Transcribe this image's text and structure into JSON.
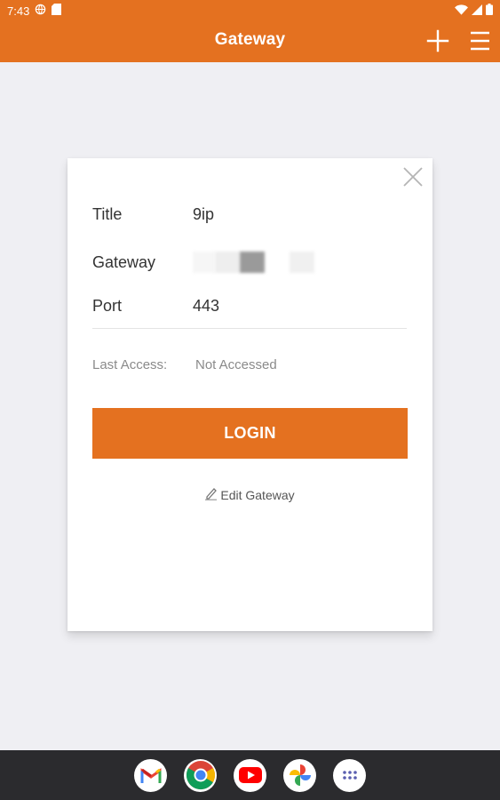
{
  "statusbar": {
    "time": "7:43"
  },
  "appbar": {
    "title": "Gateway"
  },
  "card": {
    "title_label": "Title",
    "title_value": "9ip",
    "gateway_label": "Gateway",
    "port_label": "Port",
    "port_value": "443",
    "last_access_label": "Last Access:",
    "last_access_value": "Not Accessed",
    "login_label": "LOGIN",
    "edit_label": "Edit Gateway"
  },
  "colors": {
    "accent": "#e47120",
    "background": "#efeff3",
    "navbar": "#2b2b2e"
  },
  "dock": [
    {
      "name": "gmail-icon"
    },
    {
      "name": "chrome-icon"
    },
    {
      "name": "youtube-icon"
    },
    {
      "name": "photos-icon"
    },
    {
      "name": "app-drawer-icon"
    }
  ]
}
